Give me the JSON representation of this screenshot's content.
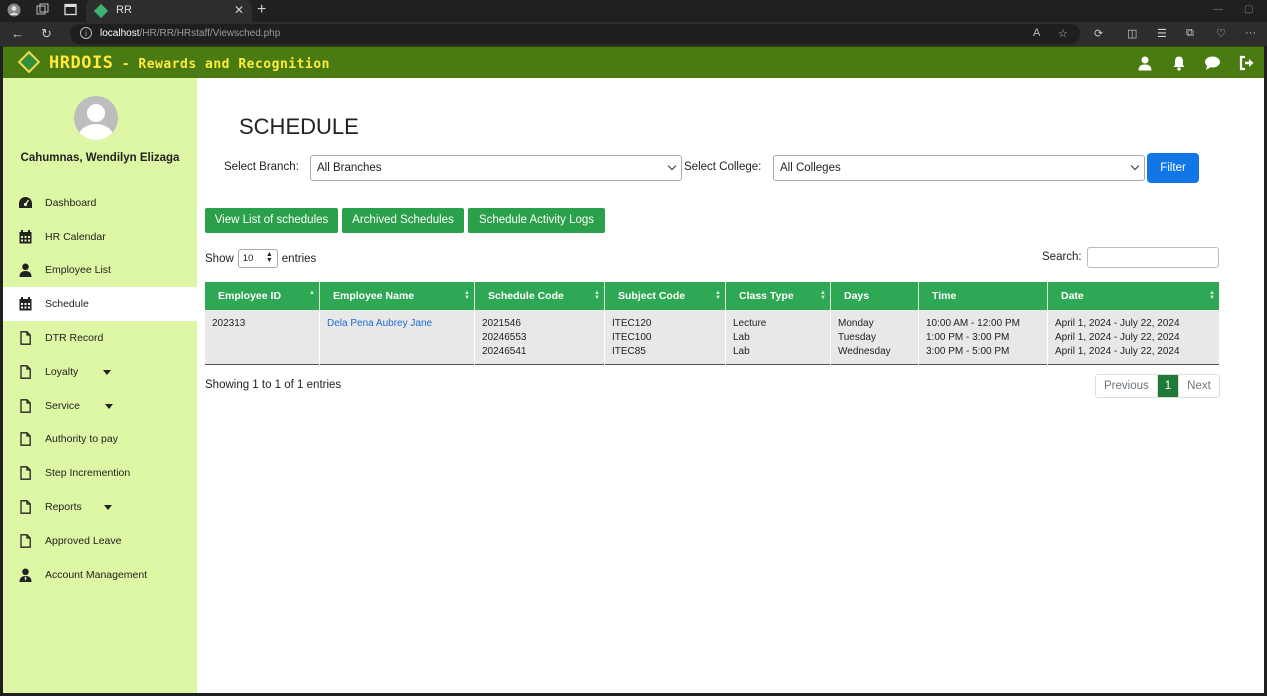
{
  "browser": {
    "tab_title": "RR",
    "url_host": "localhost",
    "url_path": "/HR/RR/HRstaff/Viewsched.php"
  },
  "header": {
    "brand_name": "HRDOIS",
    "brand_sub": " - Rewards and Recognition"
  },
  "sidebar": {
    "user_name": "Cahumnas, Wendilyn Elizaga",
    "items": [
      {
        "label": "Dashboard",
        "icon": "dashboard-icon"
      },
      {
        "label": "HR Calendar",
        "icon": "calendar-icon"
      },
      {
        "label": "Employee List",
        "icon": "user-icon"
      },
      {
        "label": "Schedule",
        "icon": "calendar-icon"
      },
      {
        "label": "DTR Record",
        "icon": "file-icon"
      },
      {
        "label": "Loyalty",
        "icon": "file-icon"
      },
      {
        "label": "Service",
        "icon": "file-icon"
      },
      {
        "label": "Authority to pay",
        "icon": "file-icon"
      },
      {
        "label": "Step Incremention",
        "icon": "file-icon"
      },
      {
        "label": "Reports",
        "icon": "file-icon"
      },
      {
        "label": "Approved Leave",
        "icon": "file-icon"
      },
      {
        "label": "Account Management",
        "icon": "user-tie-icon"
      }
    ]
  },
  "main": {
    "title": "SCHEDULE",
    "branch_label": "Select Branch:",
    "branch_value": "All Branches",
    "college_label": "Select College:",
    "college_value": "All Colleges",
    "filter_label": "Filter",
    "buttons": {
      "view_list": "View List of schedules",
      "archived": "Archived Schedules",
      "activity_logs": "Schedule Activity Logs"
    },
    "show_label": "Show",
    "entries_value": "10",
    "entries_label": "entries",
    "search_label": "Search:",
    "table": {
      "headers": [
        "Employee ID",
        "Employee Name",
        "Schedule Code",
        "Subject Code",
        "Class Type",
        "Days",
        "Time",
        "Date"
      ],
      "row": {
        "employee_id": "202313",
        "employee_name": "Dela Pena Aubrey Jane",
        "schedule_codes": [
          "2021546",
          "20246553",
          "20246541"
        ],
        "subject_codes": [
          "ITEC120",
          "ITEC100",
          "ITEC85"
        ],
        "class_types": [
          "Lecture",
          "Lab",
          "Lab"
        ],
        "days": [
          "Monday",
          "Tuesday",
          "Wednesday"
        ],
        "times": [
          "10:00 AM - 12:00 PM",
          "1:00 PM - 3:00 PM",
          "3:00 PM - 5:00 PM"
        ],
        "dates": [
          "April 1, 2024 - July 22, 2024",
          "April 1, 2024 - July 22, 2024",
          "April 1, 2024 - July 22, 2024"
        ]
      }
    },
    "info_text": "Showing 1 to 1 of 1 entries",
    "pagination": {
      "previous": "Previous",
      "current": "1",
      "next": "Next"
    }
  },
  "colors": {
    "topbar": "#4a7a12",
    "sidebar": "#def7a4",
    "green_button": "#2aa04a",
    "table_header": "#2fa855",
    "filter_button": "#1177e6"
  }
}
